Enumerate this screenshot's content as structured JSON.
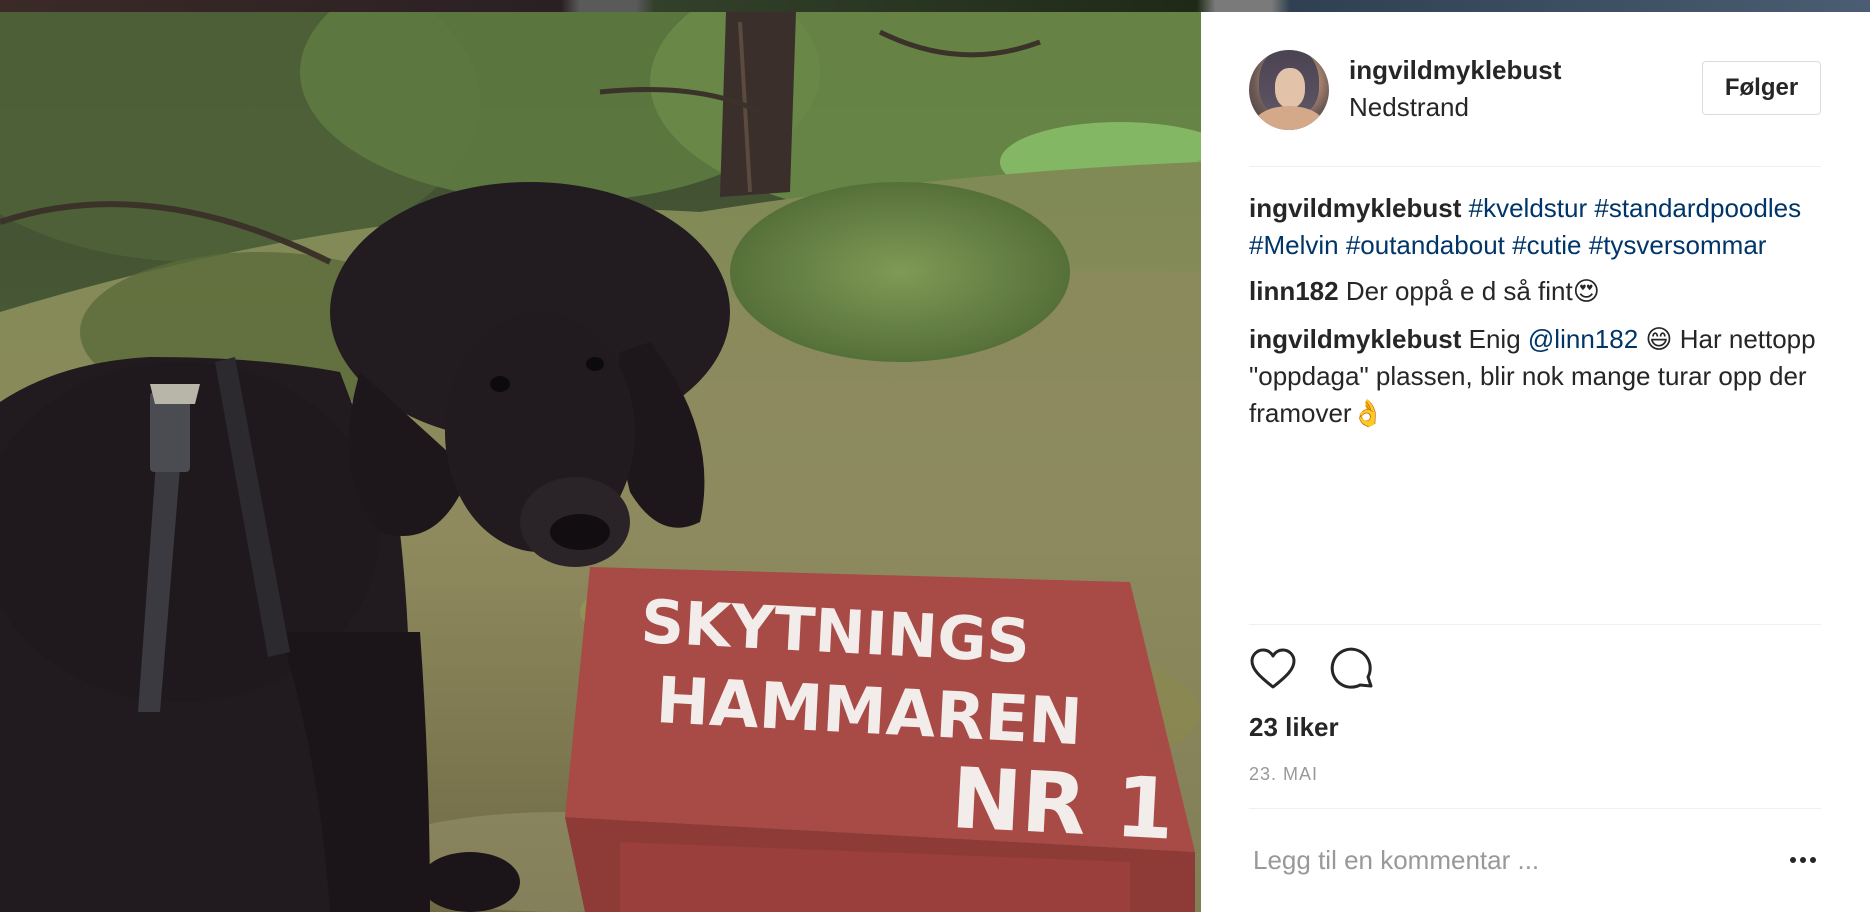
{
  "post": {
    "username": "ingvildmyklebust",
    "location": "Nedstrand",
    "follow_label": "Følger",
    "photo_sign": {
      "line1": "SKYTNINGS",
      "line2": "HAMMAREN",
      "line3": "NR 1"
    },
    "caption": {
      "author": "ingvildmyklebust",
      "tags": [
        "#kveldstur",
        "#standardpoodles",
        "#Melvin",
        "#outandabout",
        "#cutie",
        "#tysversommar"
      ]
    },
    "comments": [
      {
        "author": "linn182",
        "text": "Der oppå e d så fint",
        "emoji": "😍"
      },
      {
        "author": "ingvildmyklebust",
        "prefix": "Enig",
        "mention": "@linn182",
        "emoji1": "😄",
        "text": "Har nettopp \"oppdaga\" plassen, blir nok mange turar opp der framover",
        "emoji2": "👌"
      }
    ],
    "likes": "23 liker",
    "date": "23. MAI",
    "comment_placeholder": "Legg til en kommentar ...",
    "icons": {
      "like": "heart-icon",
      "comment": "comment-bubble-icon",
      "more": "more-options-icon"
    }
  }
}
